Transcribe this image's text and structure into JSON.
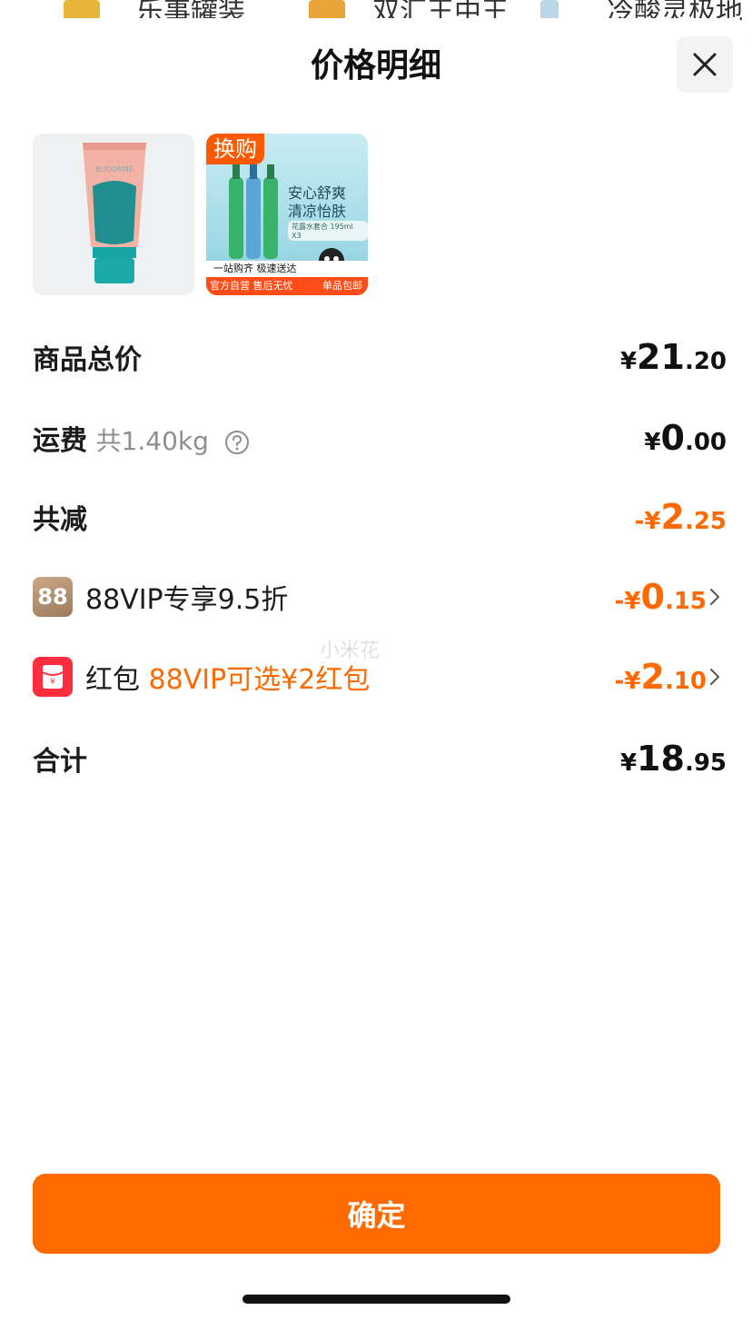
{
  "background": {
    "items": [
      "乐事罐装",
      "双汇王中王",
      "冷酸灵极地"
    ]
  },
  "sheet": {
    "title": "价格明细",
    "close_icon": "close-icon"
  },
  "products": [
    {
      "name": "BUDORME hand cream",
      "brand_text": "BUDORME"
    },
    {
      "tag": "换购",
      "line1": "安心舒爽",
      "line2": "清凉怡肤",
      "sub": "花露水套合 195ml X3",
      "bar": "一站购齐 极速送达",
      "foot_left": "官方自营 售后无忧",
      "foot_right": "单品包邮"
    }
  ],
  "rows": {
    "subtotal": {
      "label": "商品总价",
      "yen": "¥",
      "int": "21",
      "dec": ".20"
    },
    "shipping": {
      "label": "运费",
      "weight": "共1.40kg",
      "yen": "¥",
      "int": "0",
      "dec": ".00"
    },
    "discount_total": {
      "label": "共减",
      "prefix": "-¥",
      "int": "2",
      "dec": ".25"
    },
    "vip": {
      "badge": "88",
      "label": "88VIP专享9.5折",
      "prefix": "-¥",
      "int": "0",
      "dec": ".15"
    },
    "red_packet": {
      "label": "红包",
      "note": "88VIP可选¥2红包",
      "prefix": "-¥",
      "int": "2",
      "dec": ".10"
    },
    "total": {
      "label": "合计",
      "yen": "¥",
      "int": "18",
      "dec": ".95"
    }
  },
  "watermark": "小米花",
  "confirm_label": "确定",
  "colors": {
    "accent": "#ff6a00",
    "red_badge": "#ff2d3d",
    "vip_badge": "#a9876a"
  }
}
